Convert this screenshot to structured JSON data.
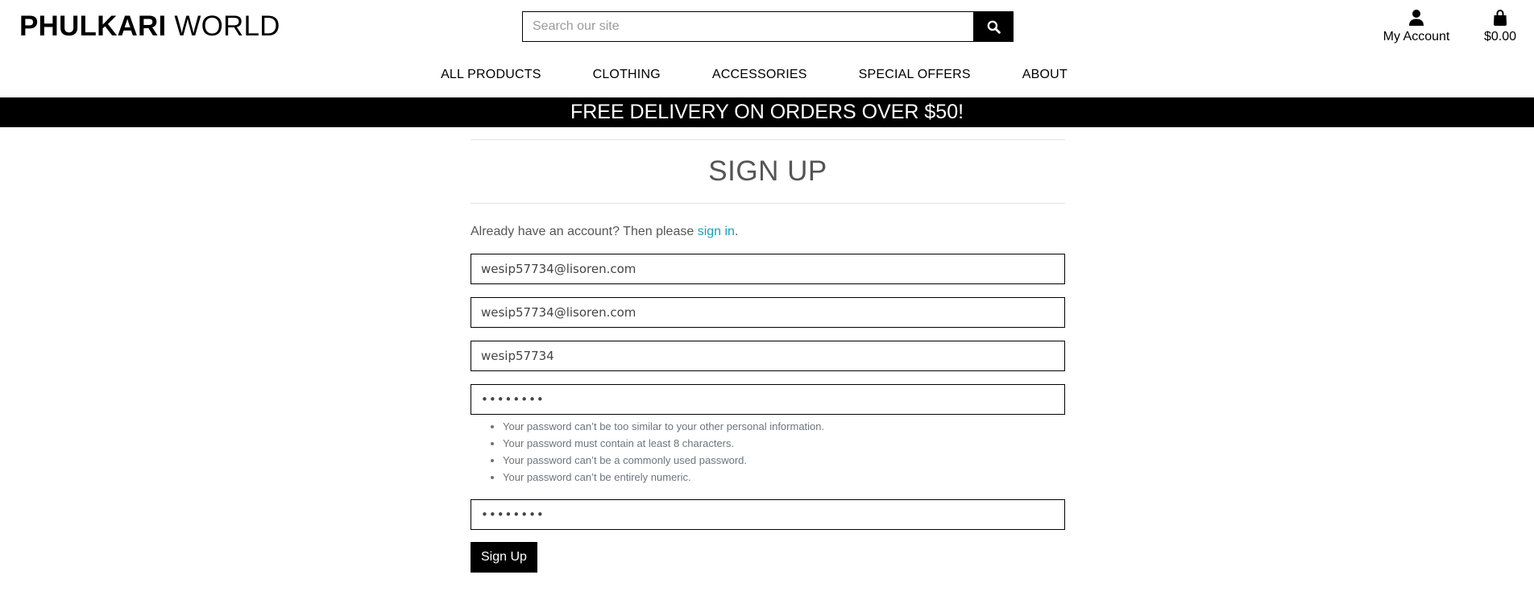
{
  "header": {
    "logo_bold": "PHULKARI",
    "logo_light": " WORLD",
    "search_placeholder": "Search our site",
    "search_icon": "search-icon",
    "account_label": "My Account",
    "account_icon": "user-icon",
    "bag_total": "$0.00",
    "bag_icon": "shopping-bag-icon"
  },
  "nav": {
    "items": [
      "ALL PRODUCTS",
      "CLOTHING",
      "ACCESSORIES",
      "SPECIAL OFFERS",
      "ABOUT"
    ]
  },
  "banner": {
    "text": "FREE DELIVERY ON ORDERS OVER $50!"
  },
  "signup": {
    "title": "SIGN UP",
    "intro_text": "Already have an account? Then please ",
    "signin_link": "sign in",
    "intro_end": ".",
    "email_value": "wesip57734@lisoren.com",
    "email_confirm_value": "wesip57734@lisoren.com",
    "username_value": "wesip57734",
    "password_value": "••••••••",
    "password_confirm_value": "••••••••",
    "password_help": [
      "Your password can’t be too similar to your other personal information.",
      "Your password must contain at least 8 characters.",
      "Your password can’t be a commonly used password.",
      "Your password can’t be entirely numeric."
    ],
    "submit_label": "Sign Up"
  },
  "colors": {
    "brand_black": "#000000",
    "link": "#17a2b8",
    "muted_text": "#6c757d",
    "title_text": "#555555"
  }
}
